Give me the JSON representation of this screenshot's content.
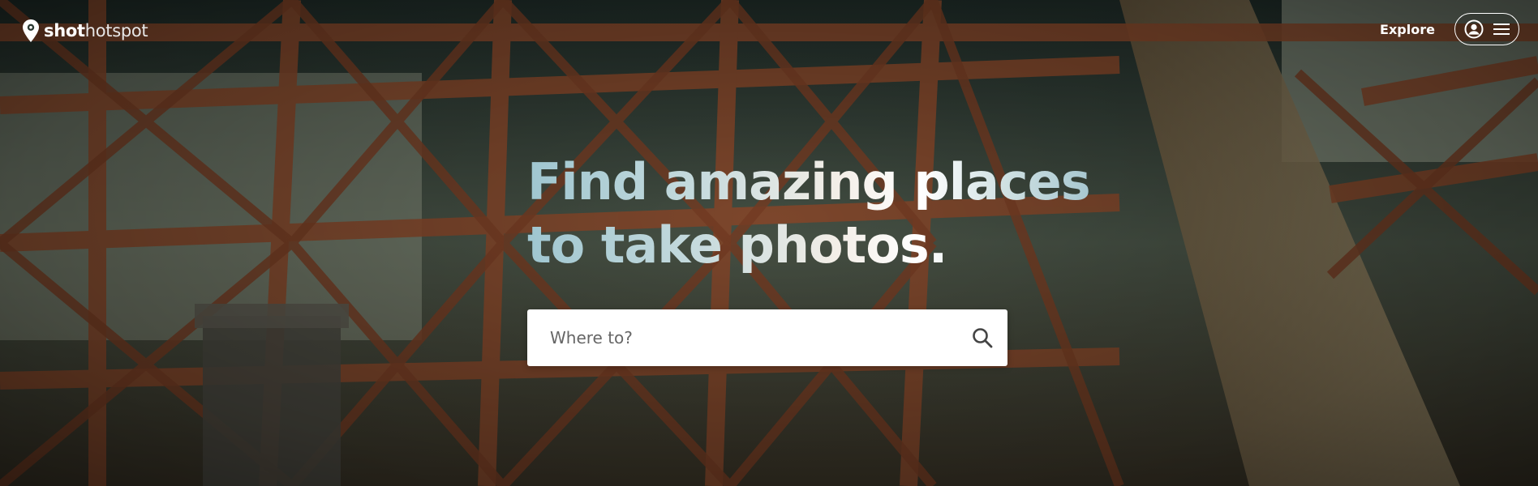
{
  "brand": {
    "name_bold": "shot",
    "name_light": "hotspot",
    "pin_icon": "map-pin-icon"
  },
  "nav": {
    "explore_label": "Explore",
    "account_icon": "user-circle-icon",
    "menu_icon": "hamburger-menu-icon"
  },
  "hero": {
    "headline_line1": "Find amazing places",
    "headline_line2": "to take photos.",
    "background": "steel bridge girders photo"
  },
  "search": {
    "placeholder": "Where to?",
    "value": "",
    "icon": "search-icon"
  },
  "colors": {
    "headline_blue": "#9fc6d0",
    "headline_white": "#ffffff",
    "search_bg": "#ffffff",
    "girder": "#8a4a2c"
  }
}
